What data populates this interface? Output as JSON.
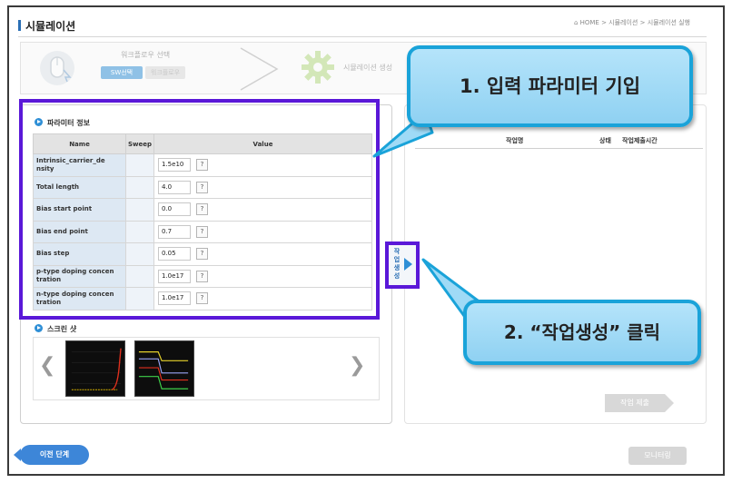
{
  "header": {
    "title": "시뮬레이션",
    "breadcrumb": "⌂ HOME > 시뮬레이션 > 시뮬레이션 실행"
  },
  "stepbar": {
    "step1_label": "워크플로우 선택",
    "step1_btn_sw": "SW선택",
    "step1_btn_workflow": "워크플로우",
    "step2_label": "시뮬레이션 생성"
  },
  "param_section": {
    "title": "파라미터 정보",
    "columns": [
      "Name",
      "Sweep",
      "Value"
    ],
    "help_label": "?",
    "rows": [
      {
        "name": "Intrinsic_carrier_density",
        "name_display": "Intrinsic_carrier_de nsity",
        "value": "1.5e10"
      },
      {
        "name": "Total length",
        "name_display": "Total length",
        "value": "4.0"
      },
      {
        "name": "Bias start point",
        "name_display": "Bias start point",
        "value": "0.0"
      },
      {
        "name": "Bias end point",
        "name_display": "Bias end point",
        "value": "0.7"
      },
      {
        "name": "Bias step",
        "name_display": "Bias step",
        "value": "0.05"
      },
      {
        "name": "p-type doping concentration",
        "name_display": "p-type doping concen tration",
        "value": "1.0e17"
      },
      {
        "name": "n-type doping concentration",
        "name_display": "n-type doping concen tration",
        "value": "1.0e17"
      }
    ]
  },
  "create_job_button": {
    "label": "작업생성"
  },
  "screenshot_section": {
    "title": "스크린 샷",
    "prev": "❮",
    "next": "❯"
  },
  "job_table": {
    "columns": [
      "작업명",
      "상태",
      "작업제출시간"
    ]
  },
  "buttons": {
    "submit": "작업 제출",
    "prev_step": "이전 단계",
    "monitor": "모니터링"
  },
  "callouts": {
    "callout1": "1. 입력 파라미터 기입",
    "callout2": "2. “작업생성” 클릭"
  },
  "colors": {
    "highlight": "#5a18d8",
    "callout_border": "#1aa3d9",
    "callout_fill": "#9fdaf6",
    "accent_blue": "#3d86d8"
  }
}
